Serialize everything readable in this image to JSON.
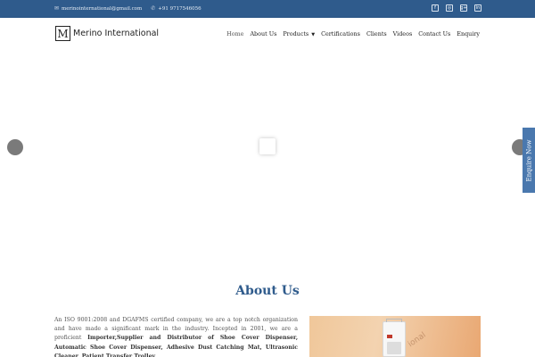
{
  "topbar": {
    "email": "merinointernational@gmail.com",
    "phone": "+91 9717546056",
    "email_icon": "envelope-icon",
    "phone_icon": "phone-icon",
    "social": [
      {
        "name": "facebook-icon",
        "glyph": "f"
      },
      {
        "name": "instagram-icon",
        "glyph": "◎"
      },
      {
        "name": "google-plus-icon",
        "glyph": "g+"
      },
      {
        "name": "linkedin-icon",
        "glyph": "in"
      }
    ]
  },
  "header": {
    "logo_letter": "M",
    "brand": "Merino International",
    "nav": [
      {
        "label": "Home",
        "active": true
      },
      {
        "label": "About Us"
      },
      {
        "label": "Products",
        "dropdown": true
      },
      {
        "label": "Certifications"
      },
      {
        "label": "Clients"
      },
      {
        "label": "Videos"
      },
      {
        "label": "Contact Us"
      },
      {
        "label": "Enquiry"
      }
    ]
  },
  "enquire_tab": "Enquire Now",
  "about": {
    "title": "About Us",
    "intro": "An ISO 9001:2008 and DGAFMS certified company, we are a top notch organization and have made a significant mark in the industry. Incepted in 2001, we are a proficient ",
    "bold": "Importer,Supplier and Distributor of Shoe Cover Dispenser, Automatic Shoe Cover Dispenser, Adhesive Dust Catching Mat, Ultrasonic Cleaner, Patient Transfer Trolley,",
    "image_watermark": "ional"
  },
  "colors": {
    "topbar_bg": "#2f5b8c",
    "accent": "#2f5b8c",
    "enquire_bg": "#4a78ae"
  }
}
